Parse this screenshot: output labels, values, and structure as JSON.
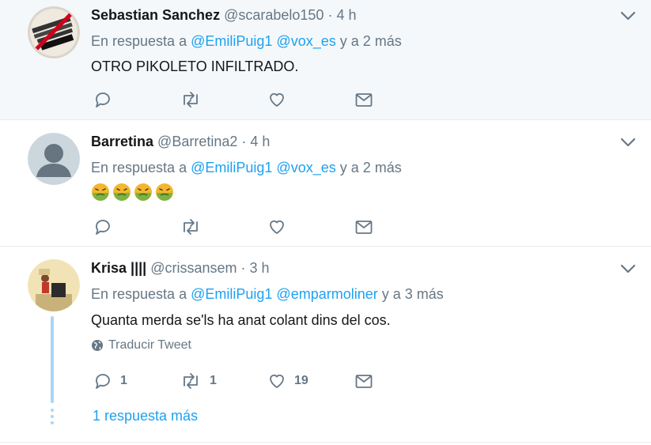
{
  "tweets": [
    {
      "name": "Sebastian Sanchez",
      "handle": "@scarabelo150",
      "dot": "·",
      "time": "4 h",
      "reply_prefix": "En respuesta a",
      "mention1": "@EmiliPuig1",
      "mention2": "@vox_es",
      "reply_suffix": "y a 2 más",
      "text": "OTRO PIKOLETO INFILTRADO.",
      "avatar_stamp_text": "LA JUSTICIA ESPANYOLA NO EXISTEIX IDIOTA!"
    },
    {
      "name": "Barretina",
      "handle": "@Barretina2",
      "dot": "·",
      "time": "4 h",
      "reply_prefix": "En respuesta a",
      "mention1": "@EmiliPuig1",
      "mention2": "@vox_es",
      "reply_suffix": "y a 2 más",
      "emoji_count": 4
    },
    {
      "name": "Krisa ||||",
      "handle": "@crissansem",
      "dot": "·",
      "time": "3 h",
      "reply_prefix": "En respuesta a",
      "mention1": "@EmiliPuig1",
      "mention2": "@emparmoliner",
      "reply_suffix": "y a 3 más",
      "text": "Quanta merda se'ls ha anat colant dins del cos.",
      "translate": "Traducir Tweet",
      "reply_count": "1",
      "retweet_count": "1",
      "like_count": "19",
      "more_replies": "1 respuesta más"
    }
  ],
  "colors": {
    "link": "#1da1f2",
    "muted": "#657786",
    "highlight_bg": "#f5f8fa",
    "thread_line": "#a7d7f5"
  },
  "icons": [
    "reply-icon",
    "retweet-icon",
    "like-icon",
    "message-icon",
    "chevron-down-icon",
    "globe-icon",
    "nauseated-face-emoji"
  ]
}
